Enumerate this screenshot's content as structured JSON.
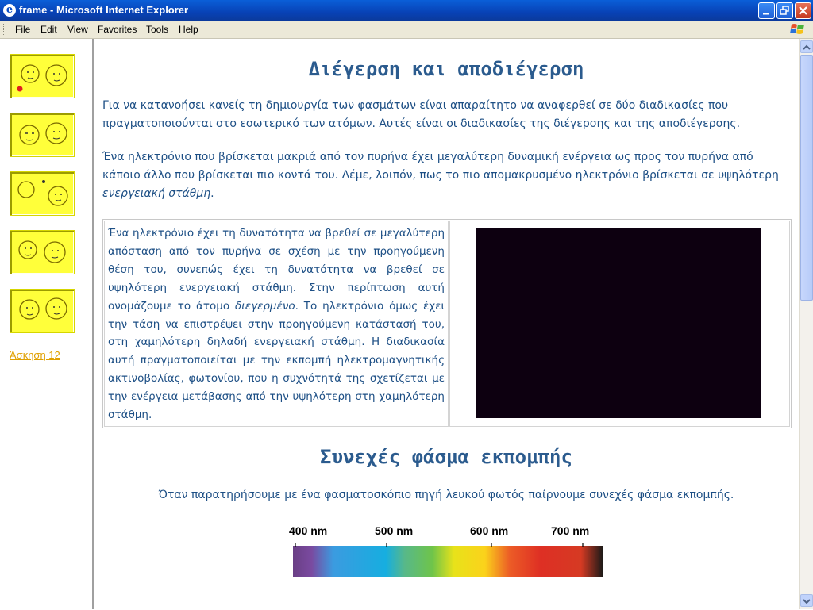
{
  "window": {
    "title": "frame - Microsoft Internet Explorer"
  },
  "menu": {
    "items": [
      "File",
      "Edit",
      "View",
      "Favorites",
      "Tools",
      "Help"
    ]
  },
  "sidebar": {
    "buttons": [
      "nav-button-1",
      "nav-button-2",
      "nav-button-3",
      "nav-button-4",
      "nav-button-5"
    ],
    "link": "Άσκηση 12"
  },
  "content": {
    "heading1": "Διέγερση και αποδιέγερση",
    "para1": "Για να κατανοήσει κανείς τη δημιουργία των φασμάτων είναι απαραίτητο να αναφερθεί σε δύο διαδικασίες που πραγματοποιούνται στο εσωτερικό των ατόμων. Αυτές είναι οι διαδικασίες της διέγερσης και της αποδιέγερσης.",
    "para2_main": "Ένα ηλεκτρόνιο που βρίσκεται μακριά από τον πυρήνα έχει μεγαλύτερη δυναμική ενέργεια ως προς τον πυρήνα από κάποιο άλλο που βρίσκεται πιο κοντά του. Λέμε, λοιπόν, πως το πιο απομακρυσμένο ηλεκτρόνιο βρίσκεται σε υψηλότερη ",
    "para2_em": "ενεργειακή στάθμη",
    "para2_end": ".",
    "box_text_a": "Ένα ηλεκτρόνιο έχει τη δυνατότητα να βρεθεί σε μεγαλύτερη απόσταση από τον πυρήνα σε σχέση με την προηγούμενη θέση του, συνεπώς έχει τη δυνατότητα να βρεθεί σε υψηλότερη ενεργειακή στάθμη. Στην περίπτωση αυτή ονομάζουμε το άτομο ",
    "box_text_em": "διεγερμένο",
    "box_text_b": ". Το ηλεκτρόνιο όμως έχει την τάση να επιστρέψει στην προηγούμενη κατάστασή του, στη χαμηλότερη δηλαδή ενεργειακή στάθμη. Η διαδικασία αυτή πραγματοποιείται με την εκπομπή ηλεκτρομαγνητικής ακτινοβολίας, φωτονίου, που η συχνότητά της σχετίζεται με την ενέργεια μετάβασης από την υψηλότερη στη χαμηλότερη στάθμη.",
    "heading2": "Συνεχές φάσμα εκπομπής",
    "caption": "Όταν παρατηρήσουμε με ένα φασματοσκόπιο πηγή λευκού φωτός παίρνουμε συνεχές φάσμα εκπομπής.",
    "spectrum_labels": [
      "400 nm",
      "500 nm",
      "600 nm",
      "700 nm"
    ]
  },
  "colors": {
    "text": "#1d4f85",
    "heading": "#2b5b8e",
    "nav_button": "#ffff3a",
    "link": "#e0a000",
    "titlebar": "#0842b6"
  }
}
